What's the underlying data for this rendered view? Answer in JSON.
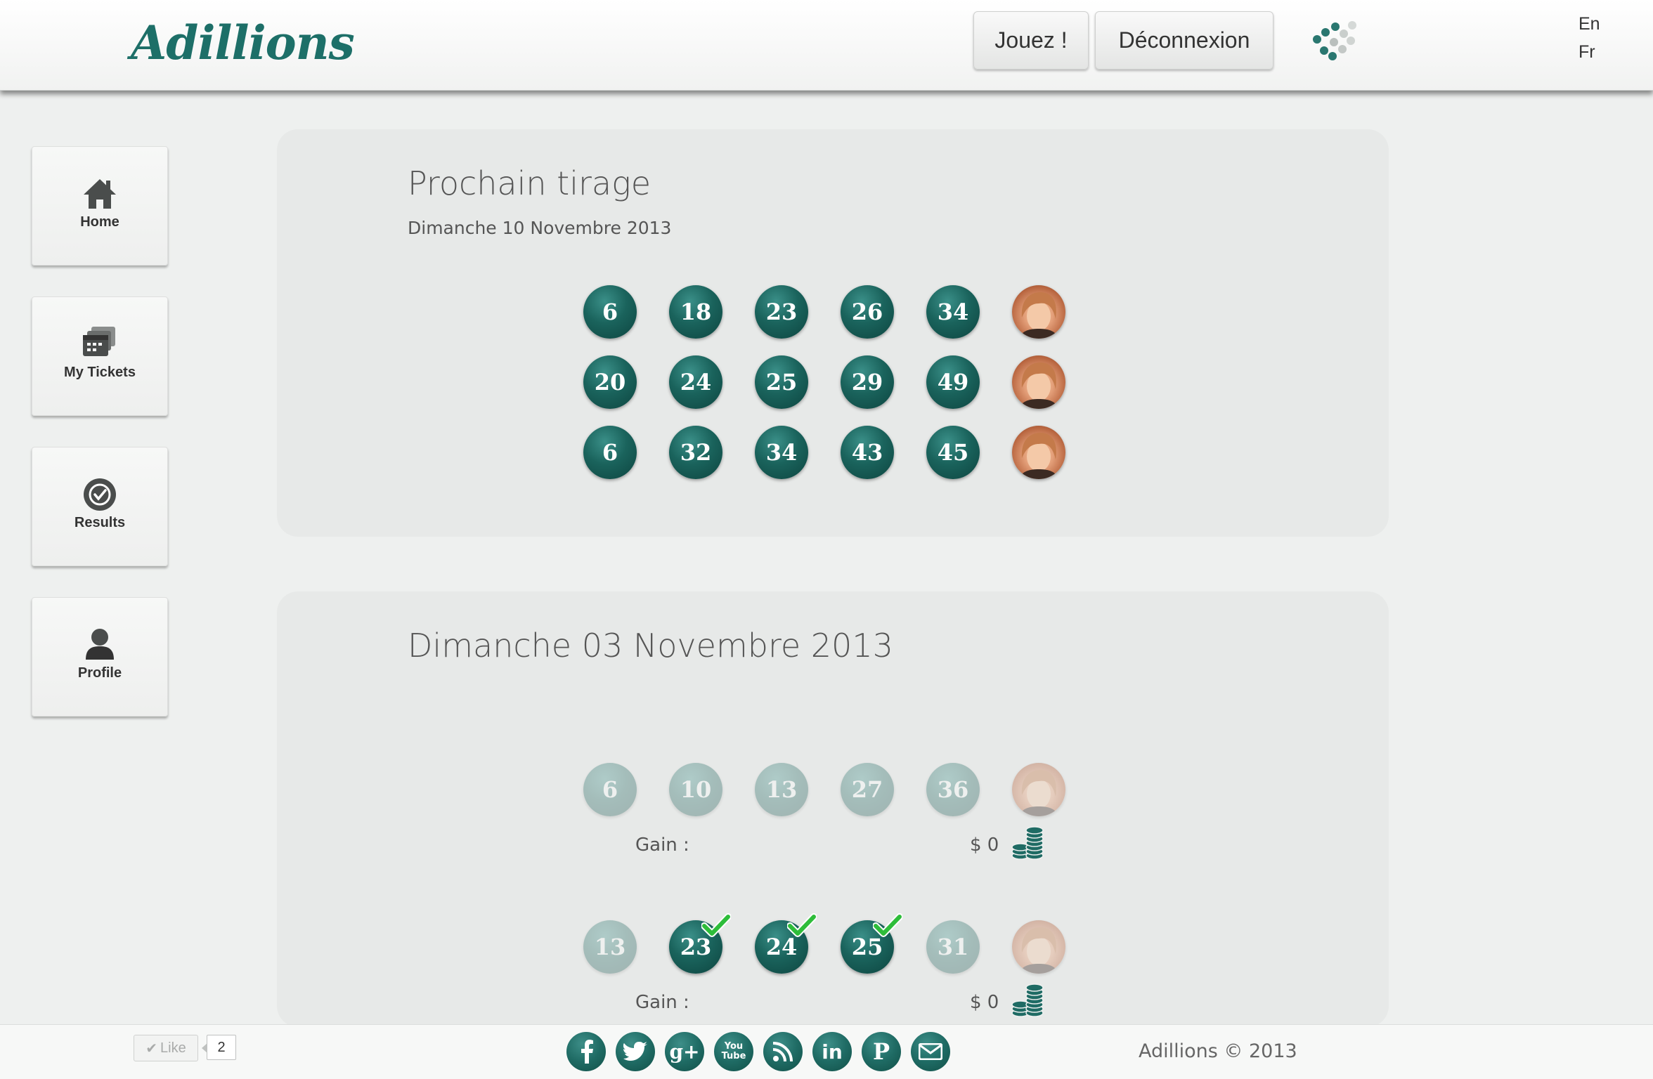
{
  "header": {
    "logo": "Adillions",
    "play_label": "Jouez !",
    "logout_label": "Déconnexion",
    "lang_en": "En",
    "lang_fr": "Fr",
    "loader_icon": "dots-loader-icon"
  },
  "sidebar": {
    "items": [
      {
        "label": "Home",
        "icon": "home-icon"
      },
      {
        "label": "My Tickets",
        "icon": "tickets-icon"
      },
      {
        "label": "Results",
        "icon": "checkmark-circle-icon"
      },
      {
        "label": "Profile",
        "icon": "user-icon"
      }
    ]
  },
  "next_draw": {
    "title": "Prochain tirage",
    "date": "Dimanche 10 Novembre 2013",
    "tickets": [
      {
        "numbers": [
          "6",
          "18",
          "23",
          "26",
          "34"
        ],
        "bonus_icon": "portrait-icon"
      },
      {
        "numbers": [
          "20",
          "24",
          "25",
          "29",
          "49"
        ],
        "bonus_icon": "portrait-icon"
      },
      {
        "numbers": [
          "6",
          "32",
          "34",
          "43",
          "45"
        ],
        "bonus_icon": "portrait-icon"
      }
    ]
  },
  "past_draw": {
    "title": "Dimanche 03 Novembre 2013",
    "tickets": [
      {
        "numbers": [
          "6",
          "10",
          "13",
          "27",
          "36"
        ],
        "matched": [
          false,
          false,
          false,
          false,
          false
        ],
        "gain_label": "Gain :",
        "gain_value": "$ 0"
      },
      {
        "numbers": [
          "13",
          "23",
          "24",
          "25",
          "31"
        ],
        "matched": [
          false,
          true,
          true,
          true,
          false
        ],
        "gain_label": "Gain :",
        "gain_value": "$ 0"
      }
    ]
  },
  "footer": {
    "like_label": "Like",
    "like_count": "2",
    "social": [
      "facebook-icon",
      "twitter-icon",
      "google-plus-icon",
      "youtube-icon",
      "rss-icon",
      "linkedin-icon",
      "pinterest-icon",
      "email-icon"
    ],
    "copyright": "Adillions © 2013"
  },
  "colors": {
    "brand": "#1d6f68",
    "ball": "#1a635c",
    "check": "#2ebd3a"
  }
}
